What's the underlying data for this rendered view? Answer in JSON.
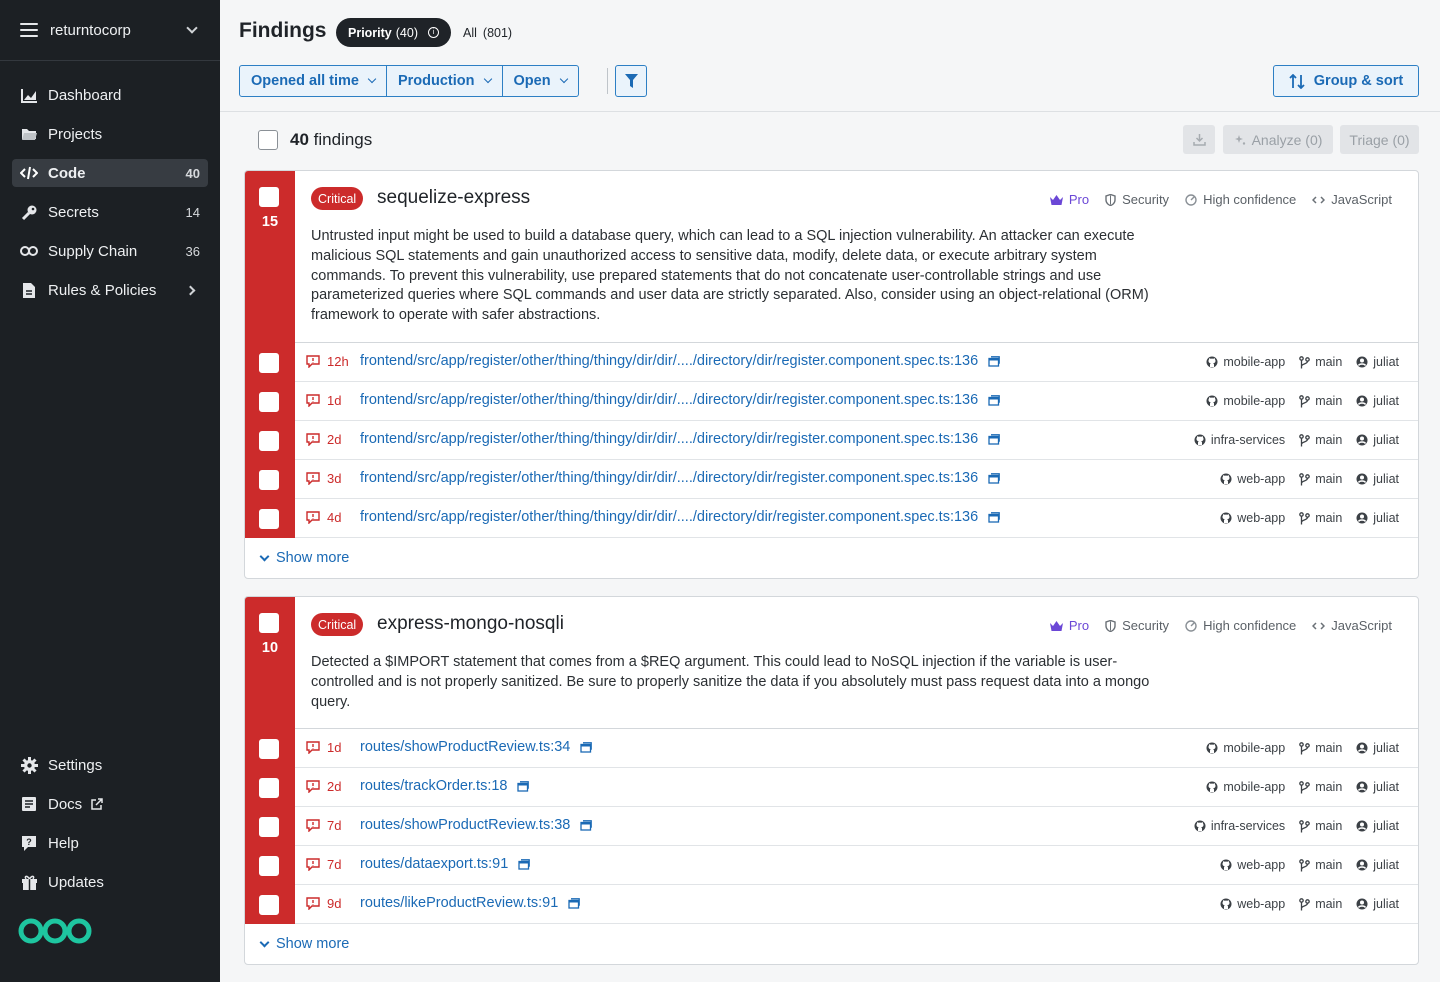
{
  "sidebar": {
    "org_name": "returntocorp",
    "items": [
      {
        "label": "Dashboard",
        "count": ""
      },
      {
        "label": "Projects",
        "count": ""
      },
      {
        "label": "Code",
        "count": "40"
      },
      {
        "label": "Secrets",
        "count": "14"
      },
      {
        "label": "Supply Chain",
        "count": "36"
      },
      {
        "label": "Rules & Policies",
        "count": ""
      }
    ],
    "bottom_items": [
      {
        "label": "Settings"
      },
      {
        "label": "Docs"
      },
      {
        "label": "Help"
      },
      {
        "label": "Updates"
      }
    ]
  },
  "header": {
    "title": "Findings",
    "priority_label": "Priority",
    "priority_count": "(40)",
    "all_label": "All",
    "all_count": "(801)",
    "filters": [
      "Opened all time",
      "Production",
      "Open"
    ],
    "group_sort_label": "Group & sort"
  },
  "listbar": {
    "count": "40",
    "count_suffix": "findings",
    "analyze_label": "Analyze (0)",
    "triage_label": "Triage (0)"
  },
  "findings": [
    {
      "count": "15",
      "severity": "Critical",
      "rule": "sequelize-express",
      "tags": {
        "pro": "Pro",
        "category": "Security",
        "confidence": "High confidence",
        "language": "JavaScript"
      },
      "description": "Untrusted input might be used to build a database query, which can lead to a SQL injection vulnerability. An attacker can execute malicious SQL statements and gain unauthorized access to sensitive data, modify, delete data, or execute arbitrary system commands. To prevent this vulnerability, use prepared statements that do not concatenate user-controllable strings and use parameterized queries where SQL commands and user data are strictly separated. Also, consider using an object-relational (ORM) framework to operate with safer abstractions.",
      "rows": [
        {
          "age": "12h",
          "path": "frontend/src/app/register/other/thing/thingy/dir/dir/..../directory/dir/register.component.spec.ts:136",
          "repo": "mobile-app",
          "branch": "main",
          "user": "juliat"
        },
        {
          "age": "1d",
          "path": "frontend/src/app/register/other/thing/thingy/dir/dir/..../directory/dir/register.component.spec.ts:136",
          "repo": "mobile-app",
          "branch": "main",
          "user": "juliat"
        },
        {
          "age": "2d",
          "path": "frontend/src/app/register/other/thing/thingy/dir/dir/..../directory/dir/register.component.spec.ts:136",
          "repo": "infra-services",
          "branch": "main",
          "user": "juliat"
        },
        {
          "age": "3d",
          "path": "frontend/src/app/register/other/thing/thingy/dir/dir/..../directory/dir/register.component.spec.ts:136",
          "repo": "web-app",
          "branch": "main",
          "user": "juliat"
        },
        {
          "age": "4d",
          "path": "frontend/src/app/register/other/thing/thingy/dir/dir/..../directory/dir/register.component.spec.ts:136",
          "repo": "web-app",
          "branch": "main",
          "user": "juliat"
        }
      ],
      "show_more": "Show more"
    },
    {
      "count": "10",
      "severity": "Critical",
      "rule": "express-mongo-nosqli",
      "tags": {
        "pro": "Pro",
        "category": "Security",
        "confidence": "High confidence",
        "language": "JavaScript"
      },
      "description": "Detected a $IMPORT statement that comes from a $REQ argument. This could lead to NoSQL injection if the variable is user-controlled and is not properly sanitized. Be sure to properly sanitize the data if you absolutely must pass request data into a mongo query.",
      "rows": [
        {
          "age": "1d",
          "path": "routes/showProductReview.ts:34",
          "repo": "mobile-app",
          "branch": "main",
          "user": "juliat"
        },
        {
          "age": "2d",
          "path": "routes/trackOrder.ts:18",
          "repo": "mobile-app",
          "branch": "main",
          "user": "juliat"
        },
        {
          "age": "7d",
          "path": "routes/showProductReview.ts:38",
          "repo": "infra-services",
          "branch": "main",
          "user": "juliat"
        },
        {
          "age": "7d",
          "path": "routes/dataexport.ts:91",
          "repo": "web-app",
          "branch": "main",
          "user": "juliat"
        },
        {
          "age": "9d",
          "path": "routes/likeProductReview.ts:91",
          "repo": "web-app",
          "branch": "main",
          "user": "juliat"
        }
      ],
      "show_more": "Show more"
    }
  ],
  "colors": {
    "sidebar_bg": "#1c2024",
    "critical": "#cc2b2b",
    "accent": "#1b6ab5",
    "pro": "#6b47d6",
    "logo": "#1ec6a0"
  }
}
